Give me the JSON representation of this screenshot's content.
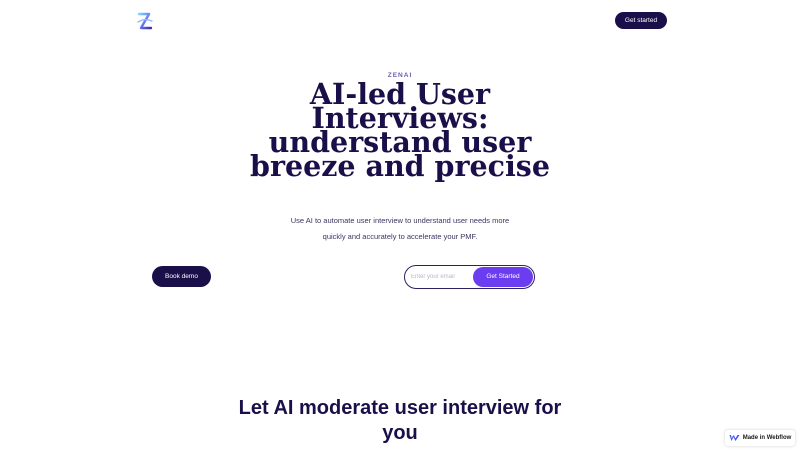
{
  "nav": {
    "logo_icon": "zenai-logo-icon",
    "cta_label": "Get started"
  },
  "hero": {
    "eyebrow": "ZENAI",
    "title": "AI-led User Interviews: understand user breeze and precise",
    "subtitle": "Use AI to automate user interview to understand user needs more quickly and accurately to accelerate your PMF.",
    "demo_button": "Book demo",
    "email_placeholder": "Enter your email",
    "submit_button": "Get Started"
  },
  "section": {
    "title": "Let AI moderate user interview for you"
  },
  "badge": {
    "icon": "webflow-icon",
    "label": "Made in Webflow"
  },
  "colors": {
    "primary_dark": "#1b0f4a",
    "accent_purple": "#6b3cf0",
    "eyebrow": "#6a5fb0",
    "background": "#ffffff"
  }
}
